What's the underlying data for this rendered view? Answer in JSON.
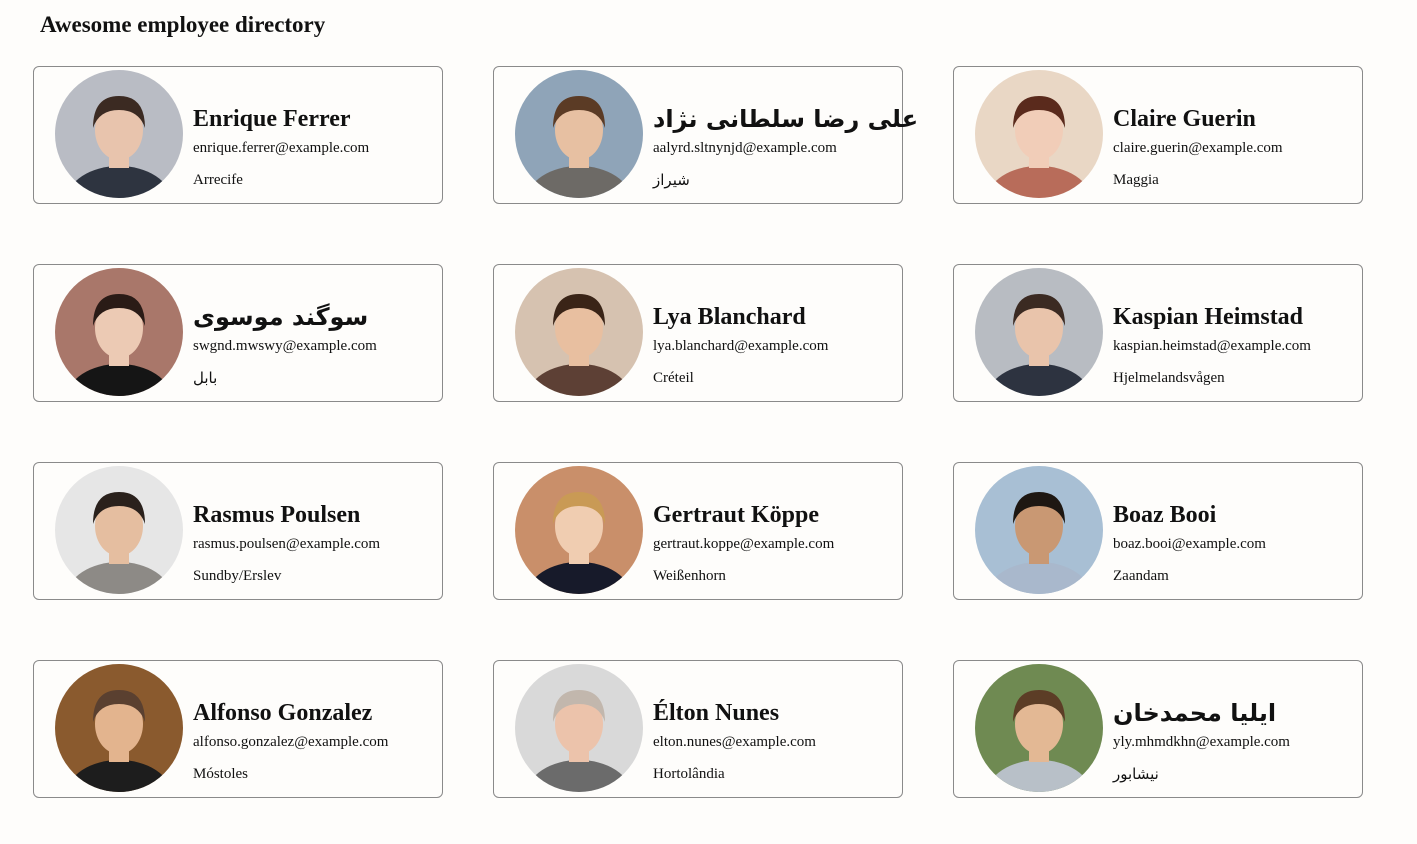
{
  "header": {
    "title": "Awesome employee directory"
  },
  "employees": [
    {
      "name": "Enrique Ferrer",
      "email": "enrique.ferrer@example.com",
      "city": "Arrecife",
      "avatar": {
        "bg": "#b9bcc4",
        "skin": "#e8c4ad",
        "hair": "#3b2a22",
        "shirt": "#2e3440"
      }
    },
    {
      "name": "علی رضا سلطانی نژاد",
      "email": "aalyrd.sltnynjd@example.com",
      "city": "شیراز",
      "avatar": {
        "bg": "#8fa4b8",
        "skin": "#e7c0a2",
        "hair": "#5b3b25",
        "shirt": "#6d6a66"
      }
    },
    {
      "name": "Claire Guerin",
      "email": "claire.guerin@example.com",
      "city": "Maggia",
      "avatar": {
        "bg": "#e9d7c5",
        "skin": "#f1cdb8",
        "hair": "#5a2a1c",
        "shirt": "#b86c5a"
      }
    },
    {
      "name": "سوگند موسوی",
      "email": "swgnd.mwswy@example.com",
      "city": "بابل",
      "avatar": {
        "bg": "#a9776a",
        "skin": "#eccab4",
        "hair": "#2a1b16",
        "shirt": "#151515"
      }
    },
    {
      "name": "Lya Blanchard",
      "email": "lya.blanchard@example.com",
      "city": "Créteil",
      "avatar": {
        "bg": "#d6c2b0",
        "skin": "#e8bfa0",
        "hair": "#3a2417",
        "shirt": "#5d4035"
      }
    },
    {
      "name": "Kaspian Heimstad",
      "email": "kaspian.heimstad@example.com",
      "city": "Hjelmelandsvågen",
      "avatar": {
        "bg": "#b8bcc2",
        "skin": "#e9c4ab",
        "hair": "#3b2a22",
        "shirt": "#2d3340"
      }
    },
    {
      "name": "Rasmus Poulsen",
      "email": "rasmus.poulsen@example.com",
      "city": "Sundby/Erslev",
      "avatar": {
        "bg": "#e6e6e6",
        "skin": "#e5bea0",
        "hair": "#2a211c",
        "shirt": "#8d8a86"
      }
    },
    {
      "name": "Gertraut Köppe",
      "email": "gertraut.koppe@example.com",
      "city": "Weißenhorn",
      "avatar": {
        "bg": "#c98f6a",
        "skin": "#f0cdb1",
        "hair": "#c99a55",
        "shirt": "#171a2a"
      }
    },
    {
      "name": "Boaz Booi",
      "email": "boaz.booi@example.com",
      "city": "Zaandam",
      "avatar": {
        "bg": "#a8bfd4",
        "skin": "#c99873",
        "hair": "#1e1712",
        "shirt": "#a9b8cc"
      }
    },
    {
      "name": "Alfonso Gonzalez",
      "email": "alfonso.gonzalez@example.com",
      "city": "Móstoles",
      "avatar": {
        "bg": "#8a5a2e",
        "skin": "#e3b48e",
        "hair": "#5a4030",
        "shirt": "#1d1d1d"
      }
    },
    {
      "name": "Élton Nunes",
      "email": "elton.nunes@example.com",
      "city": "Hortolândia",
      "avatar": {
        "bg": "#d9d9d9",
        "skin": "#ecc3ab",
        "hair": "#c2b7ad",
        "shirt": "#6b6b6b"
      }
    },
    {
      "name": "ایلیا محمدخان",
      "email": "yly.mhmdkhn@example.com",
      "city": "نیشابور",
      "avatar": {
        "bg": "#6f8a52",
        "skin": "#e3b894",
        "hair": "#5c3d26",
        "shirt": "#b8c0c8"
      }
    }
  ]
}
